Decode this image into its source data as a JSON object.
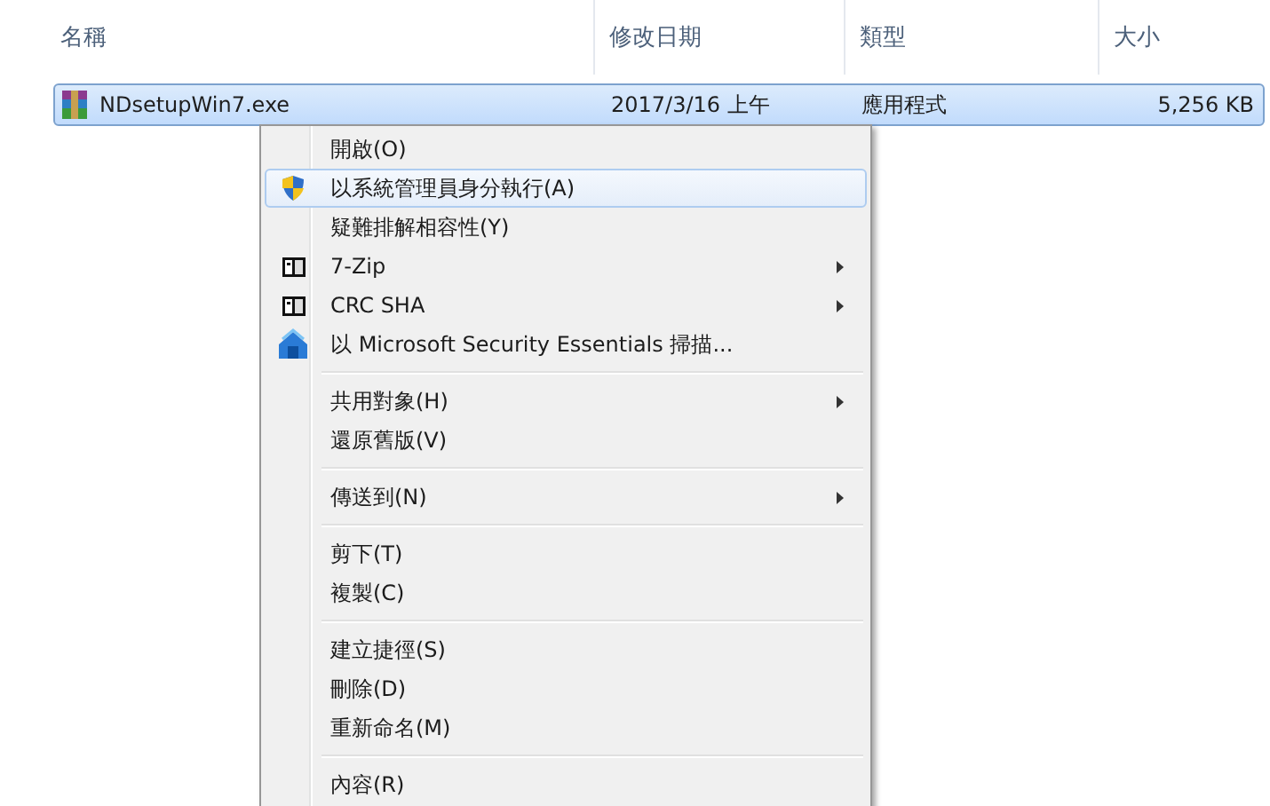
{
  "columns": [
    "名稱",
    "修改日期",
    "類型",
    "大小"
  ],
  "file": {
    "name": "NDsetupWin7.exe",
    "date": "2017/3/16 上午",
    "type": "應用程式",
    "size": "5,256 KB",
    "selected": true
  },
  "menu": [
    {
      "kind": "plain",
      "label": "開啟(O)",
      "selected": false,
      "submenu": false
    },
    {
      "kind": "shield",
      "label": "以系統管理員身分執行(A)",
      "selected": true,
      "submenu": false
    },
    {
      "kind": "plain",
      "label": "疑難排解相容性(Y)",
      "selected": false,
      "submenu": false
    },
    {
      "kind": "archive",
      "label": "7-Zip",
      "selected": false,
      "submenu": true
    },
    {
      "kind": "archive",
      "label": "CRC SHA",
      "selected": false,
      "submenu": true
    },
    {
      "kind": "scanner",
      "label": "以 Microsoft Security Essentials 掃描...",
      "selected": false,
      "submenu": false
    },
    {
      "kind": "separator"
    },
    {
      "kind": "plain",
      "label": "共用對象(H)",
      "selected": false,
      "submenu": true
    },
    {
      "kind": "plain",
      "label": "還原舊版(V)",
      "selected": false,
      "submenu": false
    },
    {
      "kind": "separator"
    },
    {
      "kind": "plain",
      "label": "傳送到(N)",
      "selected": false,
      "submenu": true
    },
    {
      "kind": "separator"
    },
    {
      "kind": "plain",
      "label": "剪下(T)",
      "selected": false,
      "submenu": false
    },
    {
      "kind": "plain",
      "label": "複製(C)",
      "selected": false,
      "submenu": false
    },
    {
      "kind": "separator"
    },
    {
      "kind": "plain",
      "label": "建立捷徑(S)",
      "selected": false,
      "submenu": false
    },
    {
      "kind": "plain",
      "label": "刪除(D)",
      "selected": false,
      "submenu": false
    },
    {
      "kind": "plain",
      "label": "重新命名(M)",
      "selected": false,
      "submenu": false
    },
    {
      "kind": "separator"
    },
    {
      "kind": "plain",
      "label": "內容(R)",
      "selected": false,
      "submenu": false
    }
  ]
}
